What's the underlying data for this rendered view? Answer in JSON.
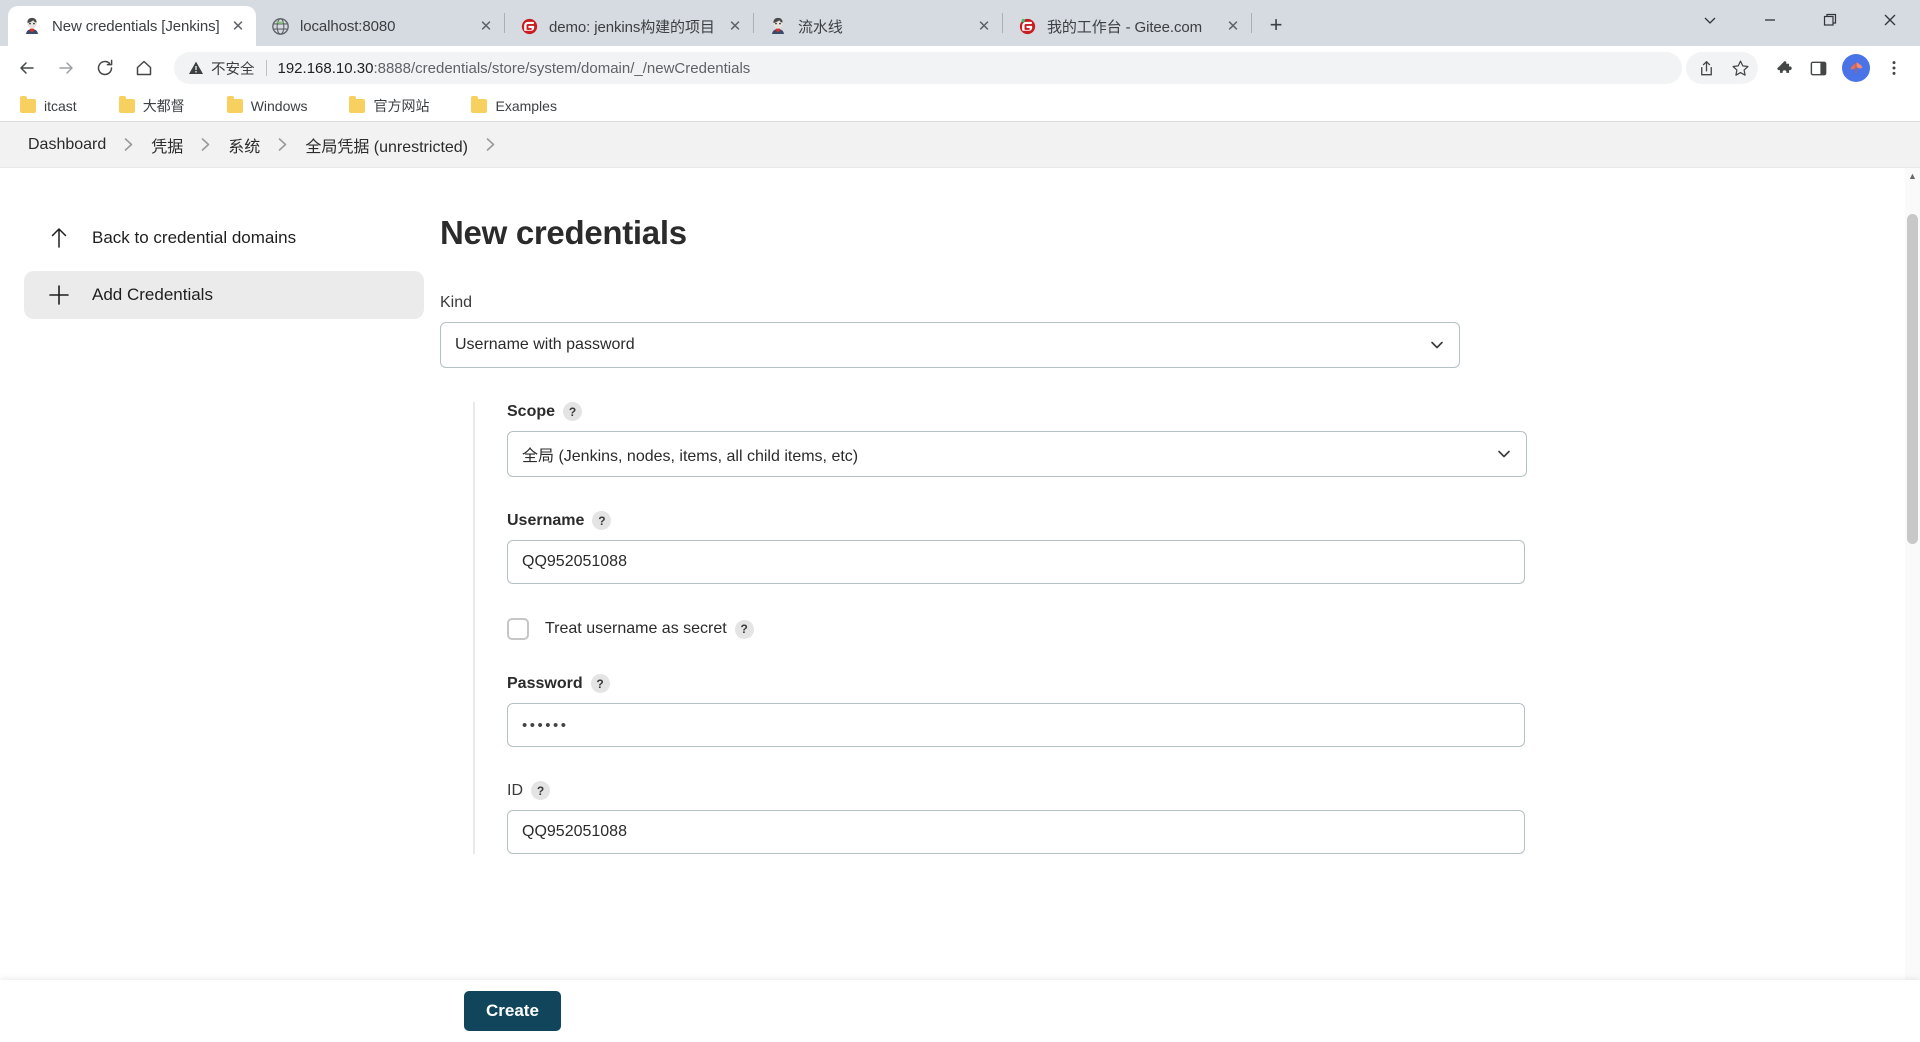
{
  "browser": {
    "tabs": [
      {
        "title": "New credentials [Jenkins]",
        "favicon": "jenkins-icon",
        "active": true
      },
      {
        "title": "localhost:8080",
        "favicon": "globe-icon",
        "active": false
      },
      {
        "title": "demo: jenkins构建的项目",
        "favicon": "gitee-icon",
        "active": false
      },
      {
        "title": "流水线",
        "favicon": "jenkins-icon",
        "active": false
      },
      {
        "title": "我的工作台 - Gitee.com",
        "favicon": "gitee-icon",
        "active": false
      }
    ],
    "new_tab_label": "+",
    "tab_close_label": "✕",
    "window_controls": {
      "minimize_tabs": "chevron-down-icon",
      "minimize": "minimize-icon",
      "maximize": "maximize-icon",
      "close": "close-icon"
    },
    "nav": {
      "back": "back-arrow-icon",
      "forward": "forward-arrow-icon",
      "reload": "reload-icon",
      "home": "home-icon"
    },
    "omnibox": {
      "security_label": "不安全",
      "url_host": "192.168.10.30",
      "url_rest": ":8888/credentials/store/system/domain/_/newCredentials"
    },
    "toolbar_icons": {
      "share": "share-icon",
      "bookmark": "star-icon",
      "extensions": "puzzle-piece-icon",
      "side_panel": "side-panel-icon",
      "profile": "profile-avatar",
      "menu": "three-dot-menu-icon"
    },
    "bookmarks": [
      {
        "label": "itcast"
      },
      {
        "label": "大都督"
      },
      {
        "label": "Windows"
      },
      {
        "label": "官方网站"
      },
      {
        "label": "Examples"
      }
    ]
  },
  "jenkins": {
    "breadcrumb": [
      {
        "label": "Dashboard"
      },
      {
        "label": "凭据"
      },
      {
        "label": "系统"
      },
      {
        "label": "全局凭据 (unrestricted)"
      }
    ],
    "breadcrumb_separator": "❯",
    "sidebar": {
      "items": [
        {
          "label": "Back to credential domains",
          "icon": "up-arrow-icon",
          "active": false
        },
        {
          "label": "Add Credentials",
          "icon": "plus-icon",
          "active": true
        }
      ]
    },
    "main": {
      "title": "New credentials",
      "kind": {
        "label": "Kind",
        "value": "Username with password",
        "options": [
          "Username with password"
        ]
      },
      "scope": {
        "label": "Scope",
        "help": "?",
        "value": "全局 (Jenkins, nodes, items, all child items, etc)",
        "options": [
          "全局 (Jenkins, nodes, items, all child items, etc)"
        ]
      },
      "username": {
        "label": "Username",
        "help": "?",
        "value": "QQ952051088"
      },
      "treat_secret": {
        "label": "Treat username as secret",
        "help": "?",
        "checked": false
      },
      "password": {
        "label": "Password",
        "help": "?",
        "value": "••••••"
      },
      "id": {
        "label": "ID",
        "help": "?",
        "value": "QQ952051088"
      },
      "submit_label": "Create"
    }
  }
}
